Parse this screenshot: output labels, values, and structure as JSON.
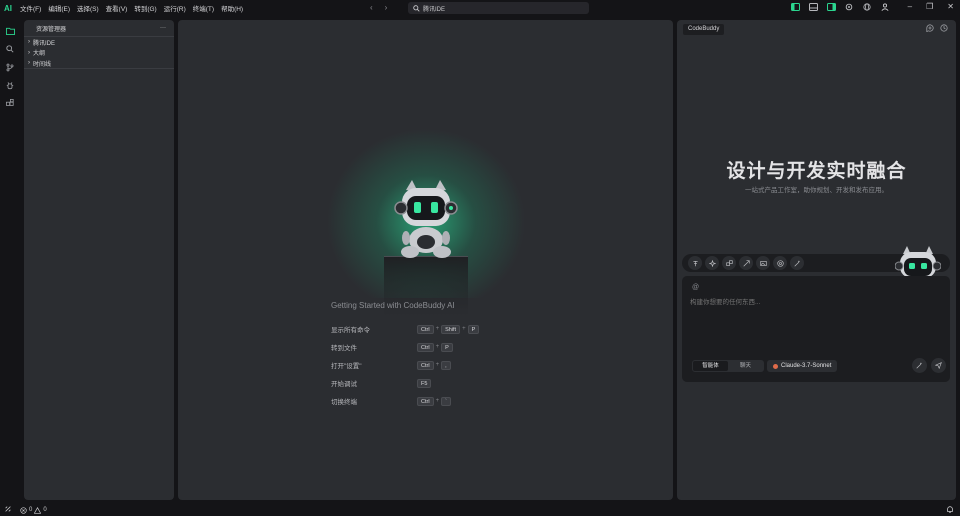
{
  "titlebar": {
    "logo": "AI",
    "menu": [
      "文件(F)",
      "编辑(E)",
      "选择(S)",
      "查看(V)",
      "转到(G)",
      "运行(R)",
      "终端(T)",
      "帮助(H)"
    ],
    "search_text": "腾讯IDE"
  },
  "activity": {
    "icons": [
      "files-icon",
      "search-icon",
      "source-control-icon",
      "debug-icon",
      "extensions-icon"
    ]
  },
  "explorer": {
    "title": "资源管理器",
    "more": "···",
    "items": [
      {
        "label": "腾讯IDE"
      },
      {
        "label": "大纲"
      },
      {
        "label": "时间线"
      }
    ]
  },
  "welcome": {
    "getting_started": "Getting Started with CodeBuddy AI",
    "shortcuts": [
      {
        "label": "显示所有命令",
        "keys": [
          "Ctrl",
          "Shift",
          "P"
        ]
      },
      {
        "label": "转到文件",
        "keys": [
          "Ctrl",
          "P"
        ]
      },
      {
        "label": "打开\"设置\"",
        "keys": [
          "Ctrl",
          ","
        ]
      },
      {
        "label": "开始调试",
        "keys": [
          "F5"
        ]
      },
      {
        "label": "切换终端",
        "keys": [
          "Ctrl",
          "`"
        ]
      }
    ]
  },
  "codebuddy": {
    "tab": "CodeBuddy",
    "headline": "设计与开发实时融合",
    "subline": "一站式产品工作室，助你规划、开发和发布应用。",
    "chat_placeholder": "构建你想要的任何东西...",
    "at_symbol": "@",
    "modes": [
      "智能体",
      "聊天"
    ],
    "model": "Claude-3.7-Sonnet"
  },
  "status": {
    "errors": "0",
    "warnings": "0"
  },
  "colors": {
    "accent": "#2bd58f",
    "panel": "#2b2d31",
    "background": "#141417"
  }
}
